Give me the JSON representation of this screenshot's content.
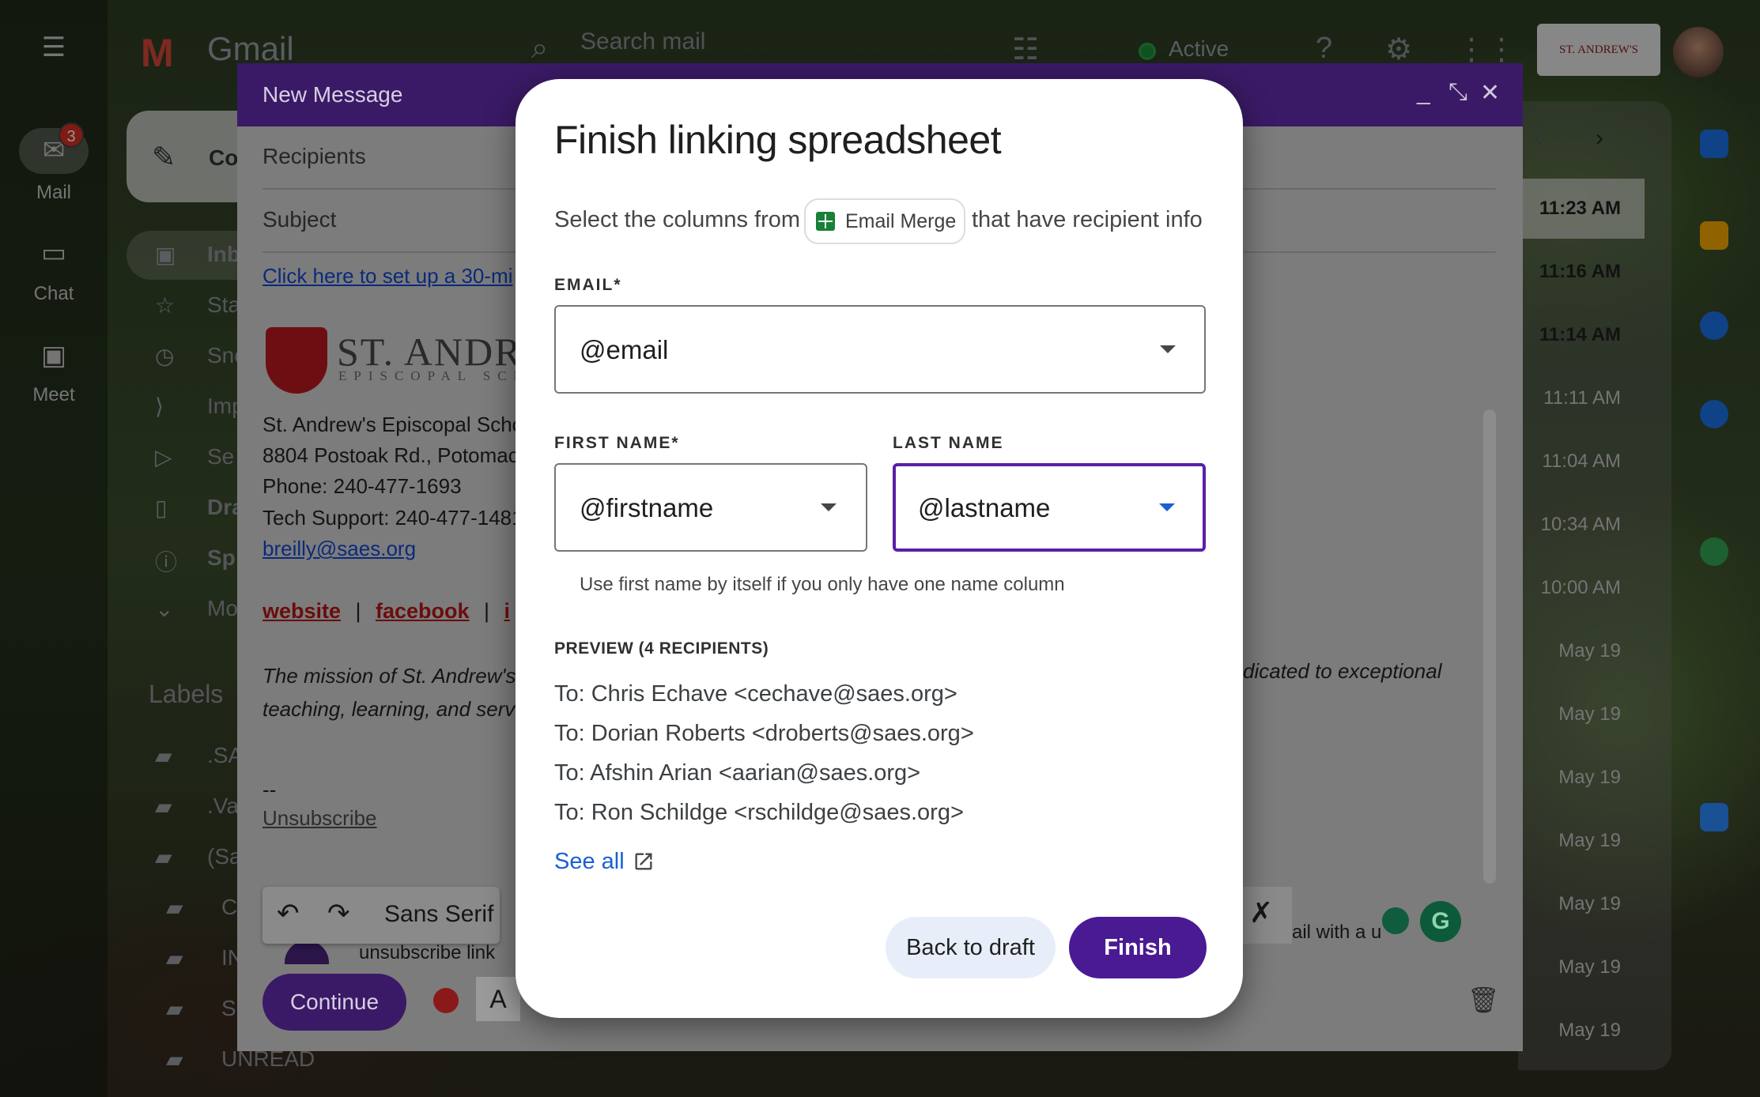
{
  "gmail": {
    "logo_word": "Gmail",
    "search_placeholder": "Search mail",
    "status": "Active",
    "school_badge": "ST. ANDREW'S"
  },
  "rail": {
    "mail_label": "Mail",
    "mail_badge": "3",
    "chat_label": "Chat",
    "meet_label": "Meet"
  },
  "inbox_sidebar": {
    "compose": "Co",
    "items": [
      "Inb",
      "Sta",
      "Sno",
      "Imp",
      "Se",
      "Dra",
      "Sp",
      "Mo"
    ],
    "labels_heading": "Labels",
    "label_items": [
      ".SA",
      ".Va",
      "(Sa",
      "C",
      "IN",
      "S",
      "UNREAD"
    ]
  },
  "message_times": [
    "11:23 AM",
    "11:16 AM",
    "11:14 AM",
    "11:11 AM",
    "11:04 AM",
    "10:34 AM",
    "10:00 AM",
    "May 19",
    "May 19",
    "May 19",
    "May 19",
    "May 19",
    "May 19",
    "May 19"
  ],
  "compose": {
    "title": "New Message",
    "recipients_label": "Recipients",
    "subject_label": "Subject",
    "setup_link": "Click here to set up a 30-mi",
    "school_name": "ST. ANDRE",
    "school_sub": "EPISCOPAL SCHO",
    "signature_lines": [
      "St. Andrew's Episcopal Scho",
      "8804 Postoak Rd., Potomac",
      "Phone: 240-477-1693",
      "Tech Support: 240-477-1481"
    ],
    "email_link": "breilly@saes.org",
    "social": {
      "website": "website",
      "sep1": "|",
      "facebook": "facebook",
      "sep2": "|",
      "third": "i"
    },
    "mission_line1": "The mission of St. Andrew's",
    "mission_line2": "teaching, learning, and serv",
    "mission_right": "dicated to exceptional",
    "dashes": "--",
    "unsubscribe": "Unsubscribe",
    "font_name": "Sans Serif",
    "bottom_text_left": "unsubscribe link",
    "bottom_text_right": "ail with a u",
    "continue_label": "Continue"
  },
  "dialog": {
    "title": "Finish linking spreadsheet",
    "subtitle_before": "Select the columns from",
    "chip_label": "Email Merge",
    "subtitle_after": "that have recipient info",
    "email_label": "EMAIL*",
    "email_value": "@email",
    "first_name_label": "FIRST NAME*",
    "first_name_value": "@firstname",
    "last_name_label": "LAST NAME",
    "last_name_value": "@lastname",
    "hint": "Use first name by itself if you only have one name column",
    "preview_label": "PREVIEW (4 RECIPIENTS)",
    "recipients": [
      "To: Chris Echave <cechave@saes.org>",
      "To: Dorian Roberts <droberts@saes.org>",
      "To: Afshin Arian <aarian@saes.org>",
      "To: Ron Schildge <rschildge@saes.org>"
    ],
    "see_all": "See all",
    "back_button": "Back to draft",
    "finish_button": "Finish"
  },
  "colors": {
    "accent_purple": "#4a1a93",
    "link_blue": "#1a5fd6",
    "compose_header": "#3a1a66"
  }
}
